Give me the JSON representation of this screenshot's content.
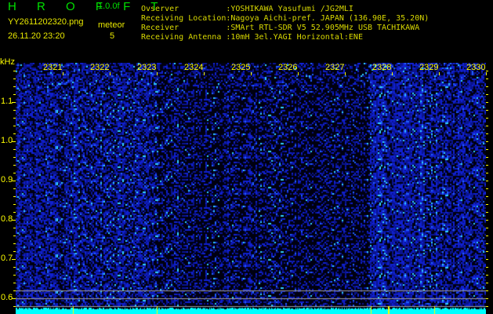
{
  "header": {
    "app_title": "H R O F F T",
    "version": "1.0.0f",
    "filename": "YY2611202320.png",
    "datetime": "26.11.20 23:20",
    "mode_label": "meteor",
    "meteor_count": "5"
  },
  "info": [
    {
      "label": "Ovserver          ",
      "value": ":YOSHIKAWA Yasufumi /JG2MLI"
    },
    {
      "label": "Receiving Location",
      "value": ":Nagoya Aichi-pref. JAPAN (136.90E, 35.20N)"
    },
    {
      "label": "Receiver          ",
      "value": ":SMArt RTL-SDR V5 52.905MHz USB TACHIKAWA"
    },
    {
      "label": "Receiving Antenna ",
      "value": ":10mH 3el.YAGI Horizontal:ENE"
    }
  ],
  "axis": {
    "y_unit": "kHz",
    "y_ticks": [
      "1.1",
      "1.0",
      "0.9",
      "0.8",
      "0.7",
      "0.6"
    ],
    "time_ticks": [
      "2321",
      "2322",
      "2323",
      "2324",
      "2325",
      "2326",
      "2327",
      "2328",
      "2329",
      "2330"
    ]
  },
  "colors": {
    "noise": "#1020e0",
    "cyan": "#00ffff",
    "text": "#ffff00",
    "title": "#00e000"
  }
}
